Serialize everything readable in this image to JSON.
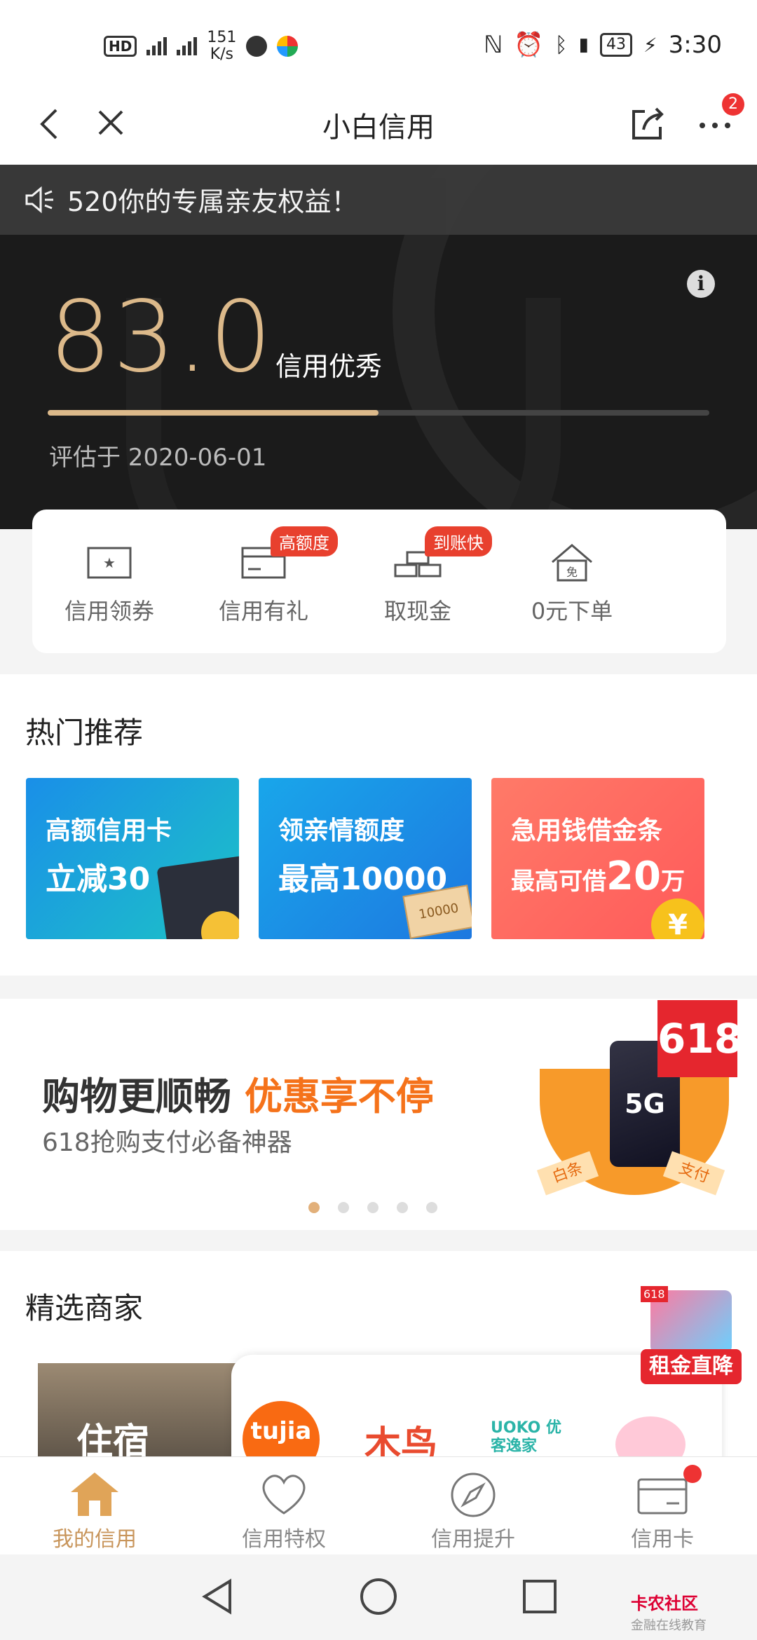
{
  "status_bar": {
    "net_speed_value": "151",
    "net_speed_unit": "K/s",
    "battery": "43",
    "time": "3:30"
  },
  "nav": {
    "title": "小白信用",
    "more_badge": "2"
  },
  "notice": "520你的专属亲友权益！",
  "credit": {
    "score": "83.0",
    "level": "信用优秀",
    "assessed": "评估于 2020-06-01",
    "progress_fraction": 0.5
  },
  "actions": [
    {
      "label": "信用领券",
      "tag": ""
    },
    {
      "label": "信用有礼",
      "tag": "高额度"
    },
    {
      "label": "取现金",
      "tag": "到账快"
    },
    {
      "label": "0元下单",
      "tag": ""
    }
  ],
  "hot": {
    "title": "热门推荐",
    "promos": [
      {
        "line1": "高额信用卡",
        "line2": "立减30"
      },
      {
        "line1": "领亲情额度",
        "line2": "最高10000",
        "note": "10000"
      },
      {
        "line1": "急用钱借金条",
        "line2_prefix": "最高可借",
        "line2_big": "20",
        "line2_suffix": "万"
      }
    ]
  },
  "banner": {
    "headline_a": "购物更顺畅",
    "headline_b": "优惠享不停",
    "sub": "618抢购支付必备神器",
    "badge": "618",
    "phone_text": "5G",
    "ribbon_left": "白条",
    "ribbon_right": "支付"
  },
  "merchants": {
    "title": "精选商家",
    "photo_text": "住宿",
    "logos": [
      "tujia",
      "木鸟",
      "UOKO 优客逸家"
    ],
    "rent_badge": "租金直降",
    "rent_badge_corner": "618"
  },
  "tabs": [
    {
      "label": "我的信用",
      "active": true
    },
    {
      "label": "信用特权",
      "active": false
    },
    {
      "label": "信用提升",
      "active": false
    },
    {
      "label": "信用卡",
      "active": false
    }
  ],
  "watermark": {
    "brand": "卡农社区",
    "sub": "金融在线教育"
  },
  "colors": {
    "gold": "#dcb98a",
    "tab_active": "#c8955b",
    "tag_red": "#e8402e",
    "banner_orange": "#f5721a"
  }
}
